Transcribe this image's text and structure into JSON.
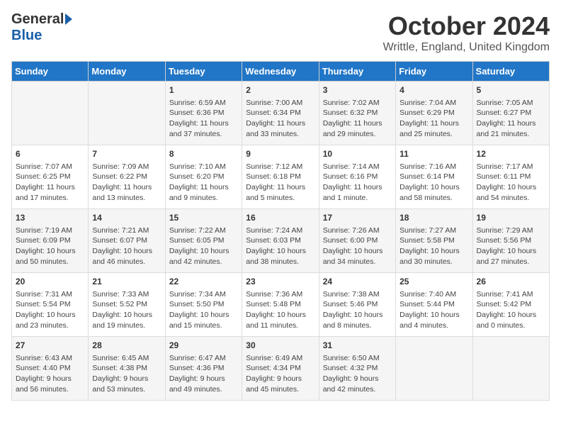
{
  "logo": {
    "general": "General",
    "blue": "Blue"
  },
  "header": {
    "month": "October 2024",
    "location": "Writtle, England, United Kingdom"
  },
  "days_of_week": [
    "Sunday",
    "Monday",
    "Tuesday",
    "Wednesday",
    "Thursday",
    "Friday",
    "Saturday"
  ],
  "weeks": [
    [
      {
        "day": "",
        "content": ""
      },
      {
        "day": "",
        "content": ""
      },
      {
        "day": "1",
        "content": "Sunrise: 6:59 AM\nSunset: 6:36 PM\nDaylight: 11 hours and 37 minutes."
      },
      {
        "day": "2",
        "content": "Sunrise: 7:00 AM\nSunset: 6:34 PM\nDaylight: 11 hours and 33 minutes."
      },
      {
        "day": "3",
        "content": "Sunrise: 7:02 AM\nSunset: 6:32 PM\nDaylight: 11 hours and 29 minutes."
      },
      {
        "day": "4",
        "content": "Sunrise: 7:04 AM\nSunset: 6:29 PM\nDaylight: 11 hours and 25 minutes."
      },
      {
        "day": "5",
        "content": "Sunrise: 7:05 AM\nSunset: 6:27 PM\nDaylight: 11 hours and 21 minutes."
      }
    ],
    [
      {
        "day": "6",
        "content": "Sunrise: 7:07 AM\nSunset: 6:25 PM\nDaylight: 11 hours and 17 minutes."
      },
      {
        "day": "7",
        "content": "Sunrise: 7:09 AM\nSunset: 6:22 PM\nDaylight: 11 hours and 13 minutes."
      },
      {
        "day": "8",
        "content": "Sunrise: 7:10 AM\nSunset: 6:20 PM\nDaylight: 11 hours and 9 minutes."
      },
      {
        "day": "9",
        "content": "Sunrise: 7:12 AM\nSunset: 6:18 PM\nDaylight: 11 hours and 5 minutes."
      },
      {
        "day": "10",
        "content": "Sunrise: 7:14 AM\nSunset: 6:16 PM\nDaylight: 11 hours and 1 minute."
      },
      {
        "day": "11",
        "content": "Sunrise: 7:16 AM\nSunset: 6:14 PM\nDaylight: 10 hours and 58 minutes."
      },
      {
        "day": "12",
        "content": "Sunrise: 7:17 AM\nSunset: 6:11 PM\nDaylight: 10 hours and 54 minutes."
      }
    ],
    [
      {
        "day": "13",
        "content": "Sunrise: 7:19 AM\nSunset: 6:09 PM\nDaylight: 10 hours and 50 minutes."
      },
      {
        "day": "14",
        "content": "Sunrise: 7:21 AM\nSunset: 6:07 PM\nDaylight: 10 hours and 46 minutes."
      },
      {
        "day": "15",
        "content": "Sunrise: 7:22 AM\nSunset: 6:05 PM\nDaylight: 10 hours and 42 minutes."
      },
      {
        "day": "16",
        "content": "Sunrise: 7:24 AM\nSunset: 6:03 PM\nDaylight: 10 hours and 38 minutes."
      },
      {
        "day": "17",
        "content": "Sunrise: 7:26 AM\nSunset: 6:00 PM\nDaylight: 10 hours and 34 minutes."
      },
      {
        "day": "18",
        "content": "Sunrise: 7:27 AM\nSunset: 5:58 PM\nDaylight: 10 hours and 30 minutes."
      },
      {
        "day": "19",
        "content": "Sunrise: 7:29 AM\nSunset: 5:56 PM\nDaylight: 10 hours and 27 minutes."
      }
    ],
    [
      {
        "day": "20",
        "content": "Sunrise: 7:31 AM\nSunset: 5:54 PM\nDaylight: 10 hours and 23 minutes."
      },
      {
        "day": "21",
        "content": "Sunrise: 7:33 AM\nSunset: 5:52 PM\nDaylight: 10 hours and 19 minutes."
      },
      {
        "day": "22",
        "content": "Sunrise: 7:34 AM\nSunset: 5:50 PM\nDaylight: 10 hours and 15 minutes."
      },
      {
        "day": "23",
        "content": "Sunrise: 7:36 AM\nSunset: 5:48 PM\nDaylight: 10 hours and 11 minutes."
      },
      {
        "day": "24",
        "content": "Sunrise: 7:38 AM\nSunset: 5:46 PM\nDaylight: 10 hours and 8 minutes."
      },
      {
        "day": "25",
        "content": "Sunrise: 7:40 AM\nSunset: 5:44 PM\nDaylight: 10 hours and 4 minutes."
      },
      {
        "day": "26",
        "content": "Sunrise: 7:41 AM\nSunset: 5:42 PM\nDaylight: 10 hours and 0 minutes."
      }
    ],
    [
      {
        "day": "27",
        "content": "Sunrise: 6:43 AM\nSunset: 4:40 PM\nDaylight: 9 hours and 56 minutes."
      },
      {
        "day": "28",
        "content": "Sunrise: 6:45 AM\nSunset: 4:38 PM\nDaylight: 9 hours and 53 minutes."
      },
      {
        "day": "29",
        "content": "Sunrise: 6:47 AM\nSunset: 4:36 PM\nDaylight: 9 hours and 49 minutes."
      },
      {
        "day": "30",
        "content": "Sunrise: 6:49 AM\nSunset: 4:34 PM\nDaylight: 9 hours and 45 minutes."
      },
      {
        "day": "31",
        "content": "Sunrise: 6:50 AM\nSunset: 4:32 PM\nDaylight: 9 hours and 42 minutes."
      },
      {
        "day": "",
        "content": ""
      },
      {
        "day": "",
        "content": ""
      }
    ]
  ]
}
